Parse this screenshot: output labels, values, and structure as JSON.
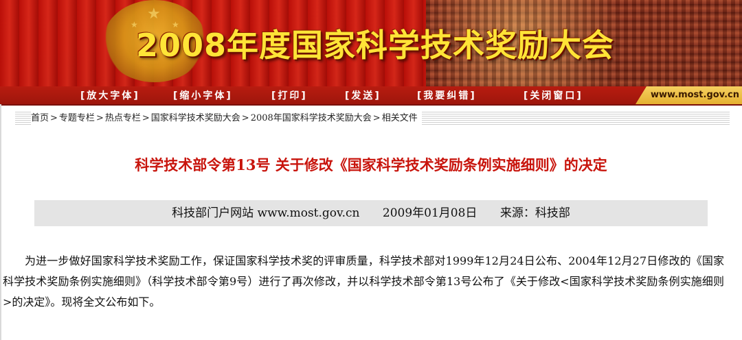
{
  "banner": {
    "title": "2008年度国家科学技术奖励大会"
  },
  "toolbar": {
    "items": [
      "[放大字体]",
      "[缩小字体]",
      "[打印]",
      "[发送]",
      "[我要纠错]",
      "[关闭窗口]"
    ],
    "site_url": "www.most.gov.cn"
  },
  "breadcrumb": {
    "items": [
      "首页",
      "专题专栏",
      "热点专栏",
      "国家科学技术奖励大会",
      "2008年国家科学技术奖励大会",
      "相关文件"
    ],
    "separator": ">"
  },
  "article": {
    "title": "科学技术部令第13号 关于修改《国家科学技术奖励条例实施细则》的决定",
    "meta": {
      "site": "科技部门户网站 www.most.gov.cn",
      "date": "2009年01月08日",
      "source": "来源：科技部"
    },
    "body": "为进一步做好国家科学技术奖励工作，保证国家科学技术奖的评审质量，科学技术部对1999年12月24日公布、2004年12月27日修改的《国家科学技术奖励条例实施细则》（科学技术部令第9号）进行了再次修改，并以科学技术部令第13号公布了《关于修改<国家科学技术奖励条例实施细则>的决定》。现将全文公布如下。"
  },
  "colors": {
    "banner_red": "#c4170d",
    "title_gold": "#ffe437",
    "article_title_red": "#c8140c",
    "meta_bg": "#e4e4e4"
  }
}
